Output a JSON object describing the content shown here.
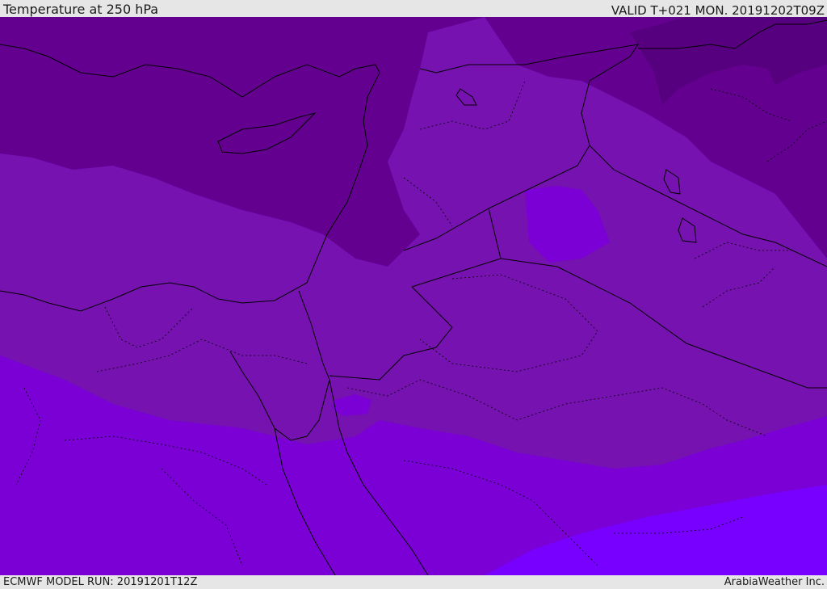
{
  "header": {
    "title": "Temperature at 250 hPa",
    "valid": "VALID T+021 MON. 20191202T09Z"
  },
  "footer": {
    "model_run": "ECMWF MODEL RUN: 20191201T12Z",
    "brand": "ArabiaWeather Inc."
  },
  "colors": {
    "darkest": "#56007f",
    "darker": "#64008f",
    "mid": "#7612af",
    "light": "#7a00d6",
    "lighter": "#7200e6",
    "lightest": "#7800ff",
    "coastline": "#000000",
    "bar_bg": "#e6e6e6"
  }
}
